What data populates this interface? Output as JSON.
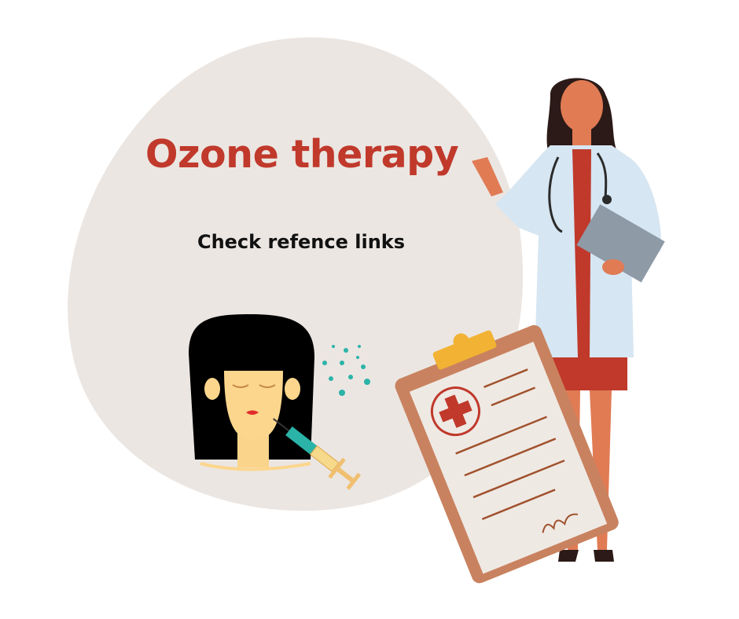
{
  "poster": {
    "title": "Ozone therapy",
    "subtitle": "Check refence links"
  },
  "colors": {
    "background": "#ffffff",
    "blob": "#ebe6e2",
    "title": "#c0392b",
    "subtitle": "#111111",
    "skin": "#e07b54",
    "coat": "#d6e6f2",
    "clipboard": "#c9825f",
    "syringe": "#2bb3a8"
  },
  "icons": [
    "doctor-illustration",
    "clipboard-icon",
    "medical-cross-icon",
    "patient-face-illustration",
    "syringe-icon",
    "ozone-dots-icon"
  ]
}
